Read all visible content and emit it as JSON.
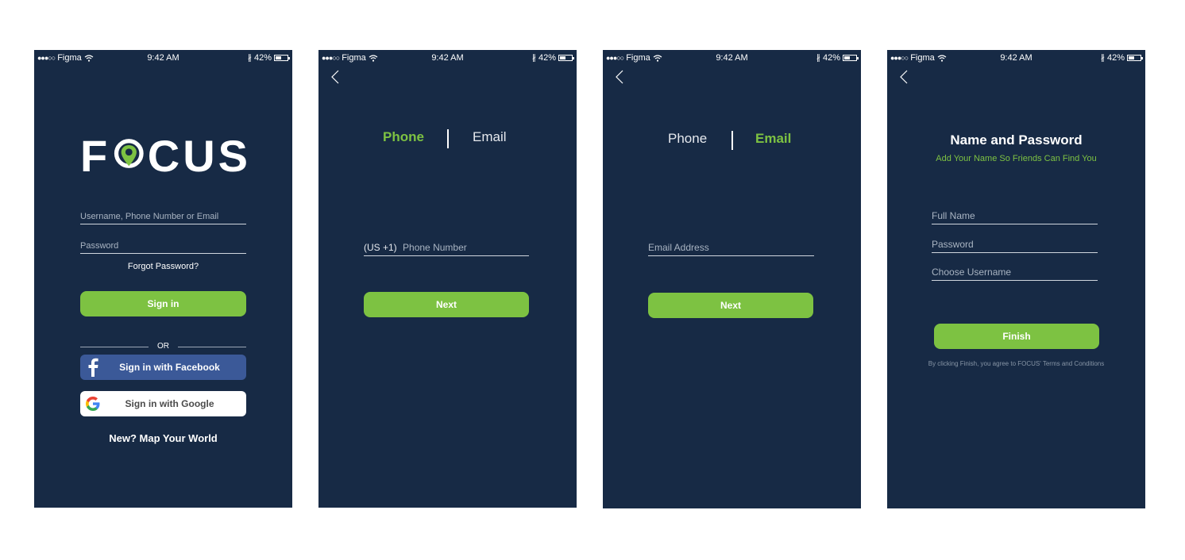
{
  "status_bar": {
    "carrier": "Figma",
    "time": "9:42 AM",
    "battery": "42%"
  },
  "screen1": {
    "logo": "FOCUS",
    "username_placeholder": "Username, Phone Number or Email",
    "password_placeholder": "Password",
    "forgot_password": "Forgot Password?",
    "sign_in": "Sign in",
    "or": "OR",
    "facebook": "Sign in with Facebook",
    "google": "Sign in with Google",
    "new_user": "New? Map Your World"
  },
  "screen2": {
    "tab_phone": "Phone",
    "tab_email": "Email",
    "country_code": "(US +1)",
    "phone_placeholder": "Phone Number",
    "next": "Next"
  },
  "screen3": {
    "tab_phone": "Phone",
    "tab_email": "Email",
    "email_placeholder": "Email Address",
    "next": "Next"
  },
  "screen4": {
    "title": "Name and Password",
    "subtitle": "Add Your Name So Friends Can Find You",
    "full_name_placeholder": "Full Name",
    "password_placeholder": "Password",
    "username_placeholder": "Choose Username",
    "finish": "Finish",
    "terms": "By clicking Finish, you agree to FOCUS' Terms and Conditions"
  },
  "colors": {
    "background": "#172a45",
    "accent": "#7dc242",
    "facebook": "#3b5998"
  },
  "icons": [
    "signal-dots-icon",
    "wifi-icon",
    "bluetooth-icon",
    "battery-icon",
    "back-chevron-icon",
    "map-pin-icon",
    "facebook-icon",
    "google-icon"
  ]
}
